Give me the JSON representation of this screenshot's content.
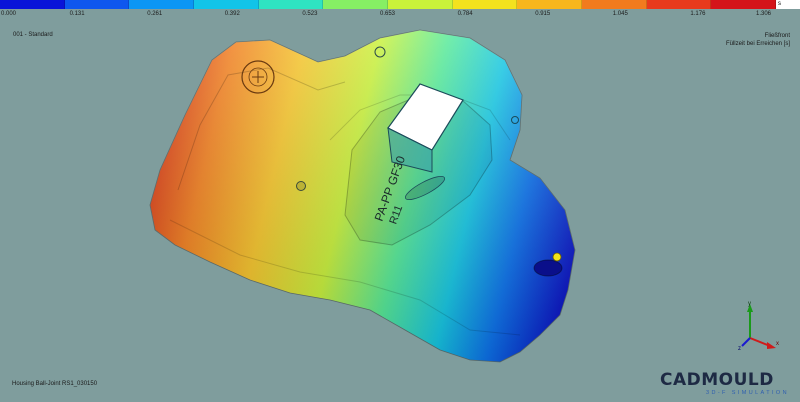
{
  "legend": {
    "ticks": [
      "0.000",
      "0.131",
      "0.261",
      "0.392",
      "0.523",
      "0.653",
      "0.784",
      "0.915",
      "1.045",
      "1.176",
      "1.306"
    ],
    "unit": "s",
    "colors": [
      "#0a14d8",
      "#0e57ee",
      "#0b96f4",
      "#12c4e8",
      "#2fe3c2",
      "#86ef64",
      "#c9f23a",
      "#f3e21e",
      "#f8b61c",
      "#f27b1e",
      "#e83a1c",
      "#d4141a"
    ]
  },
  "header": {
    "scenario": "001 - Standard",
    "result_title": "Fließfront",
    "result_subtitle": "Füllzeit bei Erreichen [s]"
  },
  "part_name": "Housing Ball-Joint RS1_030150",
  "model": {
    "part_label_1": "PA-PP GF30",
    "part_label_2": "R11"
  },
  "logo": {
    "main": "CADMOULD",
    "sub": "3D-F SIMULATION"
  },
  "triad": {
    "x_label": "x",
    "y_label": "y",
    "z_label": "z"
  }
}
